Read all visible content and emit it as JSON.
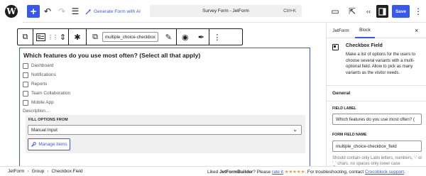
{
  "topbar": {
    "wp_logo": "W",
    "add_icon": "+",
    "undo_icon": "↶",
    "redo_icon": "↷",
    "list_view_icon": "☰",
    "generate_label": "Generate Form with AI",
    "document_title": "Survey Form - JetForm",
    "shortcut": "Ctrl+K",
    "view_icon": "▭",
    "external_icon": "⇱",
    "jetform_icon": "‹‹",
    "save_label": "Save",
    "more_icon": "⋮"
  },
  "block_toolbar": {
    "parent_icon": "⧉",
    "block_type_icon": "▤",
    "move_icon": "⋮⋮",
    "updown_icon": "⇕",
    "asterisk_icon": "✱",
    "copy_icon": "⧉",
    "field_name": "multiple_choice-checkbox",
    "edit_icon": "✎",
    "visibility_icon": "◉",
    "style_icon": "✒",
    "more_icon": "⋮"
  },
  "block": {
    "question": "Which features do you use most often? (Select all that apply)",
    "options": [
      "Dashboard",
      "Notifications",
      "Reports",
      "Team Collaboration",
      "Mobile App"
    ],
    "description_placeholder": "Description...",
    "fill_options_label": "FILL OPTIONS FROM",
    "fill_options_value": "Manual Input",
    "manage_items_label": "Manage items"
  },
  "sidebar": {
    "tab_jetform": "JetForm",
    "tab_block": "Block",
    "close_icon": "×",
    "block_title": "Checkbox Field",
    "block_description": "Make a list of options for the users to choose several variants with a multi-optional field. Allow to pick as many variants as the visitor needs.",
    "general_heading": "General",
    "field_label_heading": "FIELD LABEL",
    "field_label_value": "Which features do you use most often? (",
    "form_field_name_heading": "FORM FIELD NAME",
    "form_field_name_value": "multiple_choice-checkbox_field",
    "help_text": "Should contain only Latin letters, numbers, '-' or '_' chars, no spaces only lower case"
  },
  "footer": {
    "breadcrumbs": [
      "JetForm",
      "Group",
      "Checkbox Field"
    ],
    "promo_prefix": "Liked ",
    "promo_brand": "JetFormBuilder",
    "promo_mid": "? Please ",
    "promo_rate": "rate it",
    "promo_stars": " ★★★★★",
    "promo_after": ". For troubleshooting, contact ",
    "promo_link": "Crocoblock support",
    "promo_end": "."
  },
  "colors": {
    "accent": "#3858e9",
    "text": "#1e1e1e",
    "panel": "#f0f0f0"
  }
}
